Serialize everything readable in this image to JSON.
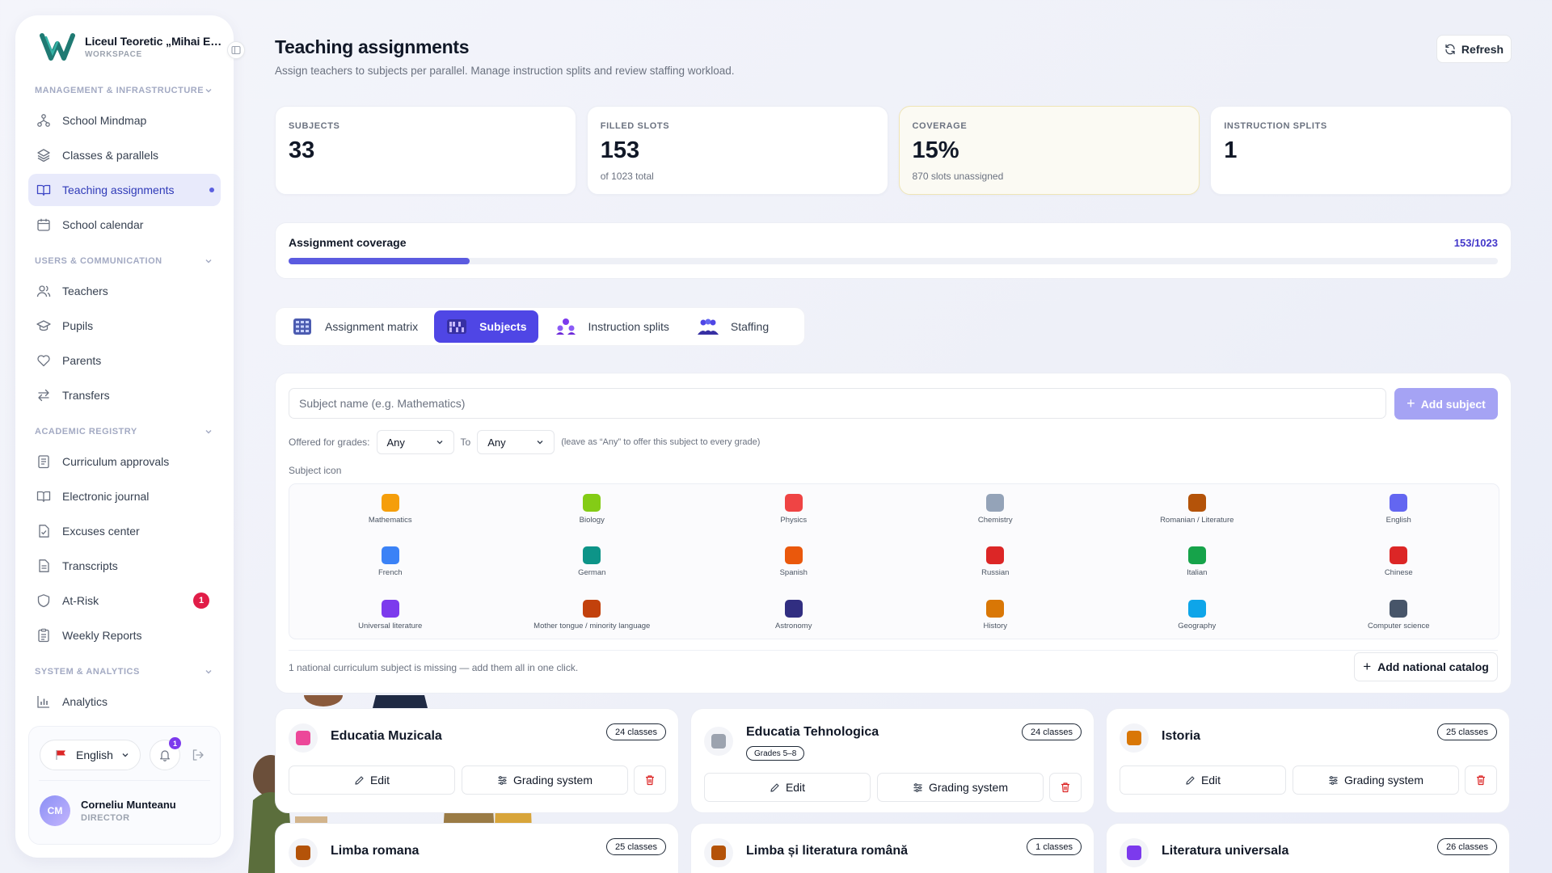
{
  "sidebar": {
    "brand_name": "Liceul Teoretic „Mihai Emine...",
    "brand_sub": "WORKSPACE",
    "sections": [
      {
        "title": "Management & Infrastructure"
      },
      {
        "title": "Users & Communication"
      },
      {
        "title": "Academic Registry"
      },
      {
        "title": "System & Analytics"
      }
    ],
    "items": [
      {
        "label": "School Mindmap",
        "icon": "mindmap-icon"
      },
      {
        "label": "Classes & parallels",
        "icon": "layers-icon"
      },
      {
        "label": "Teaching assignments",
        "icon": "book-open-icon"
      },
      {
        "label": "School calendar",
        "icon": "calendar-icon"
      },
      {
        "label": "Teachers",
        "icon": "users-icon"
      },
      {
        "label": "Pupils",
        "icon": "graduation-cap-icon"
      },
      {
        "label": "Parents",
        "icon": "heart-icon"
      },
      {
        "label": "Transfers",
        "icon": "arrows-swap-icon"
      },
      {
        "label": "Curriculum approvals",
        "icon": "clipboard-icon"
      },
      {
        "label": "Electronic journal",
        "icon": "book-icon"
      },
      {
        "label": "Excuses center",
        "icon": "file-check-icon"
      },
      {
        "label": "Transcripts",
        "icon": "file-text-icon"
      },
      {
        "label": "At-Risk",
        "icon": "shield-icon",
        "badge": "1"
      },
      {
        "label": "Weekly Reports",
        "icon": "clipboard-list-icon"
      },
      {
        "label": "Analytics",
        "icon": "bar-chart-icon"
      }
    ],
    "language": "English",
    "notifications_count": "1",
    "user_initials": "CM",
    "user_name": "Corneliu Munteanu",
    "user_role": "DIRECTOR"
  },
  "header": {
    "title": "Teaching assignments",
    "subtitle": "Assign teachers to subjects per parallel. Manage instruction splits and review staffing workload.",
    "refresh_label": "Refresh"
  },
  "stats": [
    {
      "label": "Subjects",
      "value": "33",
      "hint": ""
    },
    {
      "label": "Filled slots",
      "value": "153",
      "hint": "of 1023 total"
    },
    {
      "label": "Coverage",
      "value": "15%",
      "hint": "870 slots unassigned"
    },
    {
      "label": "Instruction splits",
      "value": "1",
      "hint": ""
    }
  ],
  "coverage": {
    "label": "Assignment coverage",
    "count": "153/1023",
    "fraction": 0.15
  },
  "tabs": [
    {
      "label": "Assignment matrix",
      "active": false
    },
    {
      "label": "Subjects",
      "active": true
    },
    {
      "label": "Instruction splits",
      "active": false
    },
    {
      "label": "Staffing",
      "active": false
    }
  ],
  "form": {
    "subject_placeholder": "Subject name (e.g. Mathematics)",
    "add_subject_label": "Add subject",
    "grades_label": "Offered for grades:",
    "from_value": "Any",
    "to_label": "To",
    "to_value": "Any",
    "grades_hint": "(leave as “Any” to offer this subject to every grade)",
    "icon_label": "Subject icon",
    "icons": [
      {
        "label": "Mathematics",
        "color": "#f59e0b"
      },
      {
        "label": "Biology",
        "color": "#84cc16"
      },
      {
        "label": "Physics",
        "color": "#ef4444"
      },
      {
        "label": "Chemistry",
        "color": "#94a3b8"
      },
      {
        "label": "Romanian / Literature",
        "color": "#b45309"
      },
      {
        "label": "English",
        "color": "#6366f1"
      },
      {
        "label": "French",
        "color": "#3b82f6"
      },
      {
        "label": "German",
        "color": "#0d9488"
      },
      {
        "label": "Spanish",
        "color": "#ea580c"
      },
      {
        "label": "Russian",
        "color": "#dc2626"
      },
      {
        "label": "Italian",
        "color": "#16a34a"
      },
      {
        "label": "Chinese",
        "color": "#dc2626"
      },
      {
        "label": "Universal literature",
        "color": "#7c3aed"
      },
      {
        "label": "Mother tongue / minority language",
        "color": "#c2410c"
      },
      {
        "label": "Astronomy",
        "color": "#312e81"
      },
      {
        "label": "History",
        "color": "#d97706"
      },
      {
        "label": "Geography",
        "color": "#0ea5e9"
      },
      {
        "label": "Computer science",
        "color": "#475569"
      }
    ],
    "missing_text": "1 national curriculum subject is missing — add them all in one click.",
    "national_label": "Add national catalog"
  },
  "subjects": [
    {
      "name": "Educatia Muzicala",
      "classes": "24 classes",
      "grades": "",
      "icon_color": "#ec4899"
    },
    {
      "name": "Educatia Tehnologica",
      "classes": "24 classes",
      "grades": "Grades 5–8",
      "icon_color": "#9ca3af"
    },
    {
      "name": "Istoria",
      "classes": "25 classes",
      "grades": "",
      "icon_color": "#d97706"
    },
    {
      "name": "Limba romana",
      "classes": "25 classes",
      "grades": "",
      "icon_color": "#b45309"
    },
    {
      "name": "Limba și literatura română",
      "classes": "1 classes",
      "grades": "",
      "icon_color": "#b45309"
    },
    {
      "name": "Literatura universala",
      "classes": "26 classes",
      "grades": "",
      "icon_color": "#7c3aed"
    }
  ],
  "subject_actions": {
    "edit": "Edit",
    "grading": "Grading system"
  }
}
